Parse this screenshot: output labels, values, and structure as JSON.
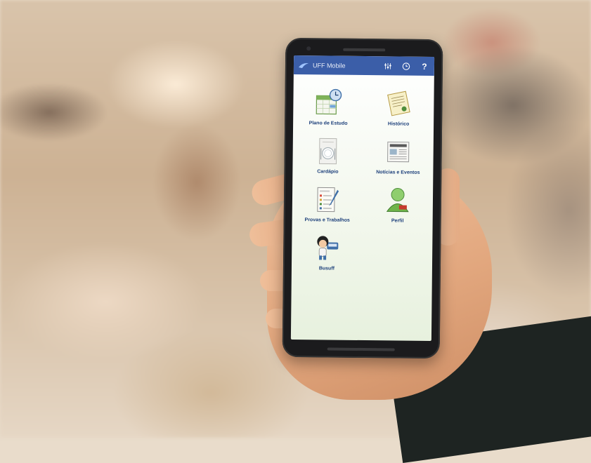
{
  "app": {
    "title": "UFF Mobile",
    "accent": "#3b5ea8",
    "label_color": "#1c3f7a"
  },
  "toolbar": {
    "icons": [
      "sliders-icon",
      "clock-icon",
      "help-icon"
    ],
    "help_glyph": "?"
  },
  "menu": {
    "items": [
      {
        "label": "Plano de Estudo",
        "icon": "calendar-clock-icon"
      },
      {
        "label": "Histórico",
        "icon": "certificate-icon"
      },
      {
        "label": "Cardápio",
        "icon": "plate-menu-icon"
      },
      {
        "label": "Notícias e Eventos",
        "icon": "newspaper-icon"
      },
      {
        "label": "Provas e Trabalhos",
        "icon": "exam-paper-icon"
      },
      {
        "label": "Perfil",
        "icon": "user-profile-icon"
      },
      {
        "label": "Busuff",
        "icon": "bus-mascot-icon"
      }
    ]
  }
}
